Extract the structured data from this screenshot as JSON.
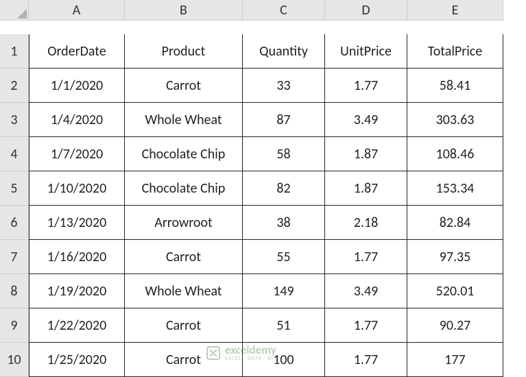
{
  "columns": [
    "A",
    "B",
    "C",
    "D",
    "E"
  ],
  "rows": [
    "1",
    "2",
    "3",
    "4",
    "5",
    "6",
    "7",
    "8",
    "9",
    "10"
  ],
  "headers": {
    "A": "OrderDate",
    "B": "Product",
    "C": "Quantity",
    "D": "UnitPrice",
    "E": "TotalPrice"
  },
  "data": [
    {
      "A": "1/1/2020",
      "B": "Carrot",
      "C": "33",
      "D": "1.77",
      "E": "58.41"
    },
    {
      "A": "1/4/2020",
      "B": "Whole Wheat",
      "C": "87",
      "D": "3.49",
      "E": "303.63"
    },
    {
      "A": "1/7/2020",
      "B": "Chocolate Chip",
      "C": "58",
      "D": "1.87",
      "E": "108.46"
    },
    {
      "A": "1/10/2020",
      "B": "Chocolate Chip",
      "C": "82",
      "D": "1.87",
      "E": "153.34"
    },
    {
      "A": "1/13/2020",
      "B": "Arrowroot",
      "C": "38",
      "D": "2.18",
      "E": "82.84"
    },
    {
      "A": "1/16/2020",
      "B": "Carrot",
      "C": "55",
      "D": "1.77",
      "E": "97.35"
    },
    {
      "A": "1/19/2020",
      "B": "Whole Wheat",
      "C": "149",
      "D": "3.49",
      "E": "520.01"
    },
    {
      "A": "1/22/2020",
      "B": "Carrot",
      "C": "51",
      "D": "1.77",
      "E": "90.27"
    },
    {
      "A": "1/25/2020",
      "B": "Carrot",
      "C": "100",
      "D": "1.77",
      "E": "177"
    }
  ],
  "watermark": {
    "name": "exceldemy",
    "sub": "EXCEL · DATA · BI"
  },
  "chart_data": {
    "type": "table",
    "title": "",
    "columns": [
      "OrderDate",
      "Product",
      "Quantity",
      "UnitPrice",
      "TotalPrice"
    ],
    "rows": [
      [
        "1/1/2020",
        "Carrot",
        33,
        1.77,
        58.41
      ],
      [
        "1/4/2020",
        "Whole Wheat",
        87,
        3.49,
        303.63
      ],
      [
        "1/7/2020",
        "Chocolate Chip",
        58,
        1.87,
        108.46
      ],
      [
        "1/10/2020",
        "Chocolate Chip",
        82,
        1.87,
        153.34
      ],
      [
        "1/13/2020",
        "Arrowroot",
        38,
        2.18,
        82.84
      ],
      [
        "1/16/2020",
        "Carrot",
        55,
        1.77,
        97.35
      ],
      [
        "1/19/2020",
        "Whole Wheat",
        149,
        3.49,
        520.01
      ],
      [
        "1/22/2020",
        "Carrot",
        51,
        1.77,
        90.27
      ],
      [
        "1/25/2020",
        "Carrot",
        100,
        1.77,
        177
      ]
    ]
  }
}
